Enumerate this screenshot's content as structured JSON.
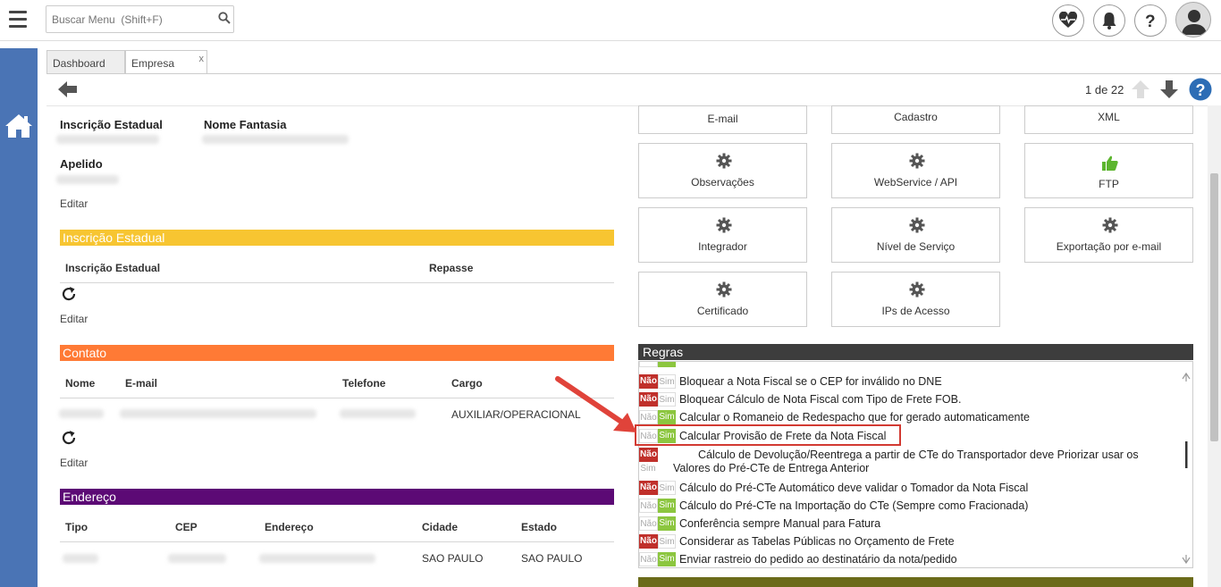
{
  "header": {
    "search_placeholder": "Buscar Menu  (Shift+F)"
  },
  "tabs": [
    {
      "label": "Dashboard"
    },
    {
      "label": "Empresa",
      "close": "x"
    }
  ],
  "pager": {
    "text": "1 de 22"
  },
  "company": {
    "ie_label": "Inscrição Estadual",
    "fantasia_label": "Nome Fantasia",
    "apelido_label": "Apelido",
    "edit": "Editar"
  },
  "sections": {
    "ie": {
      "title": "Inscrição Estadual",
      "cols": [
        "Inscrição Estadual",
        "Repasse"
      ],
      "edit": "Editar"
    },
    "contato": {
      "title": "Contato",
      "cols": [
        "Nome",
        "E-mail",
        "Telefone",
        "Cargo"
      ],
      "cargo": "AUXILIAR/OPERACIONAL",
      "edit": "Editar"
    },
    "endereco": {
      "title": "Endereço",
      "cols": [
        "Tipo",
        "CEP",
        "Endereço",
        "Cidade",
        "Estado"
      ],
      "cidade": "SAO PAULO",
      "estado": "SAO PAULO"
    }
  },
  "cards": [
    "E-mail",
    "Cadastro",
    "XML",
    "Observações",
    "WebService / API",
    "FTP",
    "Integrador",
    "Nível de Serviço",
    "Exportação por e-mail",
    "Certificado",
    "IPs de Acesso"
  ],
  "regras": {
    "title": "Regras",
    "nao": "Não",
    "sim": "Sim",
    "items": [
      {
        "text": "Bloquear a Nota Fiscal se o CEP for inválido no DNE",
        "state": "nao"
      },
      {
        "text": "Bloquear Cálculo de Nota Fiscal com Tipo de Frete FOB.",
        "state": "nao"
      },
      {
        "text": "Calcular o Romaneio de Redespacho que for gerado automaticamente",
        "state": "sim"
      },
      {
        "text": "Calcular Provisão de Frete da Nota Fiscal",
        "state": "sim"
      },
      {
        "text": "Cálculo de Devolução/Reentrega a partir de CTe do Transportador deve Priorizar usar os",
        "text2": "Valores do Pré-CTe de Entrega Anterior",
        "state": "nao"
      },
      {
        "text": "Cálculo do Pré-CTe Automático deve validar o Tomador da Nota Fiscal",
        "state": "nao"
      },
      {
        "text": "Cálculo do Pré-CTe na Importação do CTe (Sempre como Fracionada)",
        "state": "sim"
      },
      {
        "text": "Conferência sempre Manual para Fatura",
        "state": "sim"
      },
      {
        "text": "Considerar as Tabelas Públicas no Orçamento de Frete",
        "state": "nao"
      },
      {
        "text": "Enviar rastreio do pedido ao destinatário da nota/pedido",
        "state": "sim"
      }
    ]
  },
  "colors": {
    "ie": "#f7c531",
    "contato": "#ff7a35",
    "endereco": "#5c0a75",
    "regras": "#3d3d3d",
    "sidebar": "#4a74b5",
    "highlight": "#d23a32",
    "arrow": "#e0433a"
  }
}
